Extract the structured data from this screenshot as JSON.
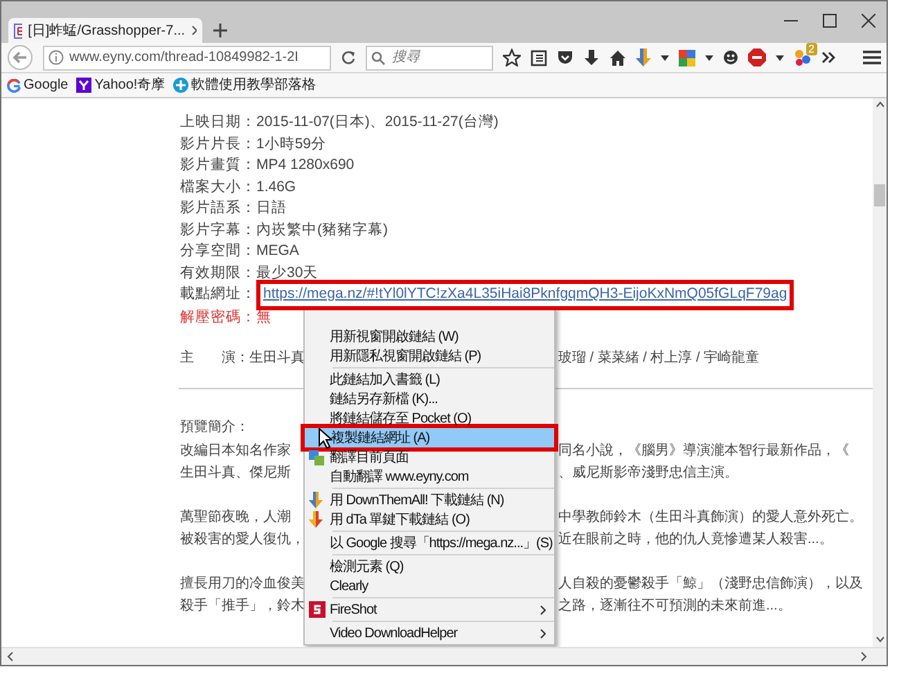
{
  "window": {
    "tab_title": "[日]蚱蜢/Grasshopper-7..."
  },
  "toolbar": {
    "url": "www.eyny.com/thread-10849982-1-2I",
    "search_placeholder": "搜尋",
    "badge": "2"
  },
  "bookmarks": [
    {
      "kind": "google",
      "label": "Google"
    },
    {
      "kind": "yahoo",
      "label": "Yahoo!奇摩"
    },
    {
      "kind": "blog",
      "label": "軟體使用教學部落格"
    }
  ],
  "page": {
    "details": [
      "上映日期：2015-11-07(日本)、2015-11-27(台灣)",
      "影片片長：1小時59分",
      "影片畫質：MP4 1280x690",
      "檔案大小：1.46G",
      "影片語系：日語",
      "影片字幕：內崁繁中(豬豬字幕)",
      "分享空間：MEGA",
      "有效期限：最少30天"
    ],
    "download": {
      "label": "載點網址：",
      "link": "https://mega.nz/#!tYl0lYTC!zXa4L35iHai8PknfgqmQH3-EijoKxNmQ05fGLqF79ag",
      "highlighted": true
    },
    "password": "解壓密碼：無",
    "cast": {
      "left": "主　　演：生田斗真",
      "right": "玻瑠 / 菜菜緒 / 村上淳 / 宇崎龍童"
    },
    "synopsis_title": "預覽簡介：",
    "paragraphs": [
      [
        {
          "left": "改編日本知名作家",
          "right": "同名小說，《腦男》導演瀧本智行最新作品，《"
        },
        {
          "left": "生田斗真、傑尼斯",
          "right": "、威尼斯影帝淺野忠信主演。"
        }
      ],
      [
        {
          "left": "萬聖節夜晚，人潮",
          "right": "中學教師鈴木（生田斗真飾演）的愛人意外死亡。"
        },
        {
          "left": "被殺害的愛人復仇，",
          "right": "近在眼前之時，他的仇人竟慘遭某人殺害...。"
        }
      ],
      [
        {
          "left": "擅長用刀的冷血俊美",
          "right": "人自殺的憂鬱殺手「鯨」（淺野忠信飾演），以及"
        },
        {
          "left": "殺手「推手」，鈴木",
          "right": "之路，逐漸往不可預測的未來前進...。"
        }
      ]
    ]
  },
  "context_menu": {
    "items": [
      {
        "kind": "item",
        "label": "用新視窗開啟鏈結 (W)",
        "selected": false,
        "highlighted": false,
        "submenu": false
      },
      {
        "kind": "item",
        "label": "用新隱私視窗開啟鏈結 (P)",
        "selected": false,
        "highlighted": false,
        "submenu": false
      },
      {
        "kind": "separator"
      },
      {
        "kind": "item",
        "label": "此鏈結加入書籤 (L)",
        "selected": false,
        "highlighted": false,
        "submenu": false
      },
      {
        "kind": "item",
        "label": "鏈結另存新檔 (K)...",
        "selected": false,
        "highlighted": false,
        "submenu": false
      },
      {
        "kind": "item",
        "label": "將鏈結儲存至 Pocket (O)",
        "selected": false,
        "highlighted": false,
        "submenu": false
      },
      {
        "kind": "item",
        "label": "複製鏈結網址 (A)",
        "selected": true,
        "highlighted": true,
        "submenu": false
      },
      {
        "kind": "translate",
        "label": "翻譯目前頁面",
        "selected": false,
        "highlighted": false,
        "submenu": false
      },
      {
        "kind": "item",
        "label": "自動翻譯 www.eyny.com",
        "selected": false,
        "highlighted": false,
        "submenu": false
      },
      {
        "kind": "separator"
      },
      {
        "kind": "download",
        "label": "用 DownThemAll! 下載鏈結 (N)",
        "selected": false,
        "highlighted": false,
        "submenu": false
      },
      {
        "kind": "quickdownload",
        "label": "用 dTa 單鍵下載鏈結 (O)",
        "selected": false,
        "highlighted": false,
        "submenu": false
      },
      {
        "kind": "separator"
      },
      {
        "kind": "item",
        "label": "以 Google 搜尋「https://mega.nz...」(S)",
        "selected": false,
        "highlighted": false,
        "submenu": false
      },
      {
        "kind": "separator"
      },
      {
        "kind": "item",
        "label": "檢測元素 (Q)",
        "selected": false,
        "highlighted": false,
        "submenu": false
      },
      {
        "kind": "item",
        "label": "Clearly",
        "selected": false,
        "highlighted": false,
        "submenu": false
      },
      {
        "kind": "separator"
      },
      {
        "kind": "capture",
        "label": "FireShot",
        "selected": false,
        "highlighted": false,
        "submenu": true
      },
      {
        "kind": "separator"
      },
      {
        "kind": "item",
        "label": "Video DownloadHelper",
        "selected": false,
        "highlighted": false,
        "submenu": true
      }
    ]
  }
}
